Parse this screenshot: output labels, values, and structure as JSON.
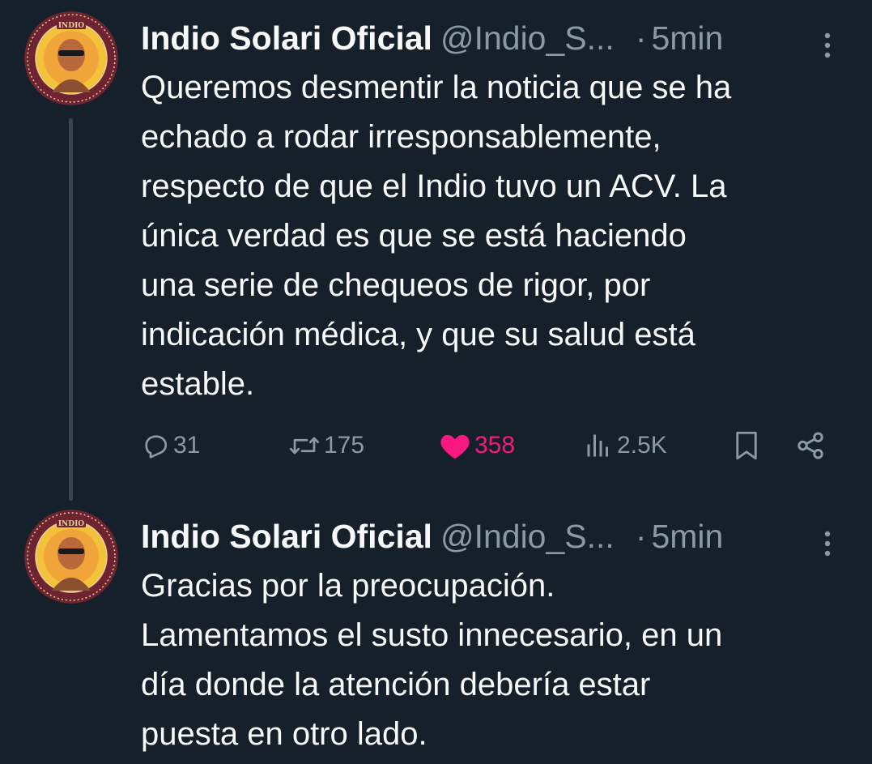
{
  "colors": {
    "background": "#15202b",
    "text_primary": "#f7f9f9",
    "text_secondary": "#8b98a5",
    "like_active": "#f91880",
    "thread_line": "#38444d"
  },
  "tweets": [
    {
      "author": {
        "display_name": "Indio Solari Oficial",
        "handle": "@Indio_S...",
        "avatar_icon": "indio-solari-avatar",
        "avatar_text": "INDIO"
      },
      "dot": "·",
      "time": "5min",
      "text_lines": [
        "Queremos desmentir la noticia que se ha",
        "echado a rodar irresponsablemente,",
        "respecto de que el Indio tuvo un ACV. La",
        "única verdad es que se está haciendo",
        "una serie de chequeos de rigor, por",
        "indicación médica, y que su salud está",
        "estable."
      ],
      "actions": {
        "replies": "31",
        "retweets": "175",
        "likes": "358",
        "views": "2.5K",
        "liked": true
      }
    },
    {
      "author": {
        "display_name": "Indio Solari Oficial",
        "handle": "@Indio_S...",
        "avatar_icon": "indio-solari-avatar",
        "avatar_text": "INDIO"
      },
      "dot": "·",
      "time": "5min",
      "text_lines": [
        "Gracias por la preocupación.",
        "Lamentamos el susto innecesario, en un",
        "día donde la atención debería estar",
        "puesta en otro lado."
      ]
    }
  ]
}
